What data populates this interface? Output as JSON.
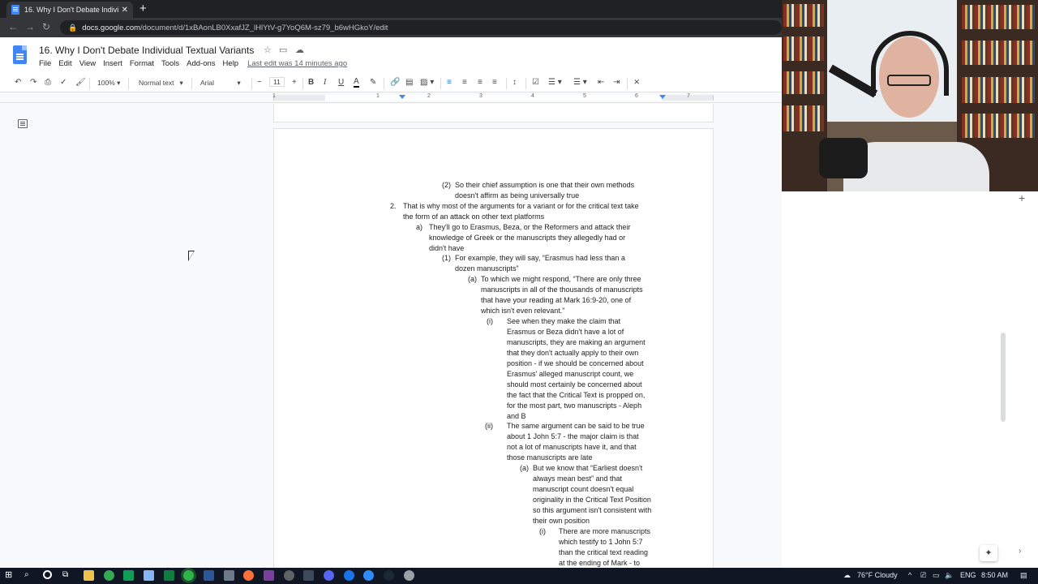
{
  "browser": {
    "tab_title": "16. Why I Don't Debate Individu",
    "url_host": "docs.google.com",
    "url_path": "/document/d/1xBAonLB0XxafJZ_lHlYtV-g7YoQ6M-sz79_b6wHGkoY/edit"
  },
  "docs": {
    "title": "16. Why I Don't Debate Individual Textual Variants",
    "menu": [
      "File",
      "Edit",
      "View",
      "Insert",
      "Format",
      "Tools",
      "Add-ons",
      "Help"
    ],
    "last_edit": "Last edit was 14 minutes ago",
    "zoom": "100%",
    "style": "Normal text",
    "font": "Arial",
    "font_size": "11"
  },
  "ruler": [
    "1",
    "1",
    "2",
    "3",
    "4",
    "5",
    "6",
    "7"
  ],
  "document_lines": [
    {
      "marker": "(2)",
      "text": "So their chief assumption is one that their own methods"
    },
    {
      "marker": "",
      "text": "doesn't affirm as being universally true"
    },
    {
      "marker": "2.",
      "text": "That is why most of the arguments for a variant or for the critical text take"
    },
    {
      "marker": "",
      "text": "the form of an attack on other text platforms"
    },
    {
      "marker": "a)",
      "text": "They'll go to Erasmus, Beza, or the Reformers and attack their"
    },
    {
      "marker": "",
      "text": "knowledge of Greek or the manuscripts they allegedly had or"
    },
    {
      "marker": "",
      "text": "didn't have"
    },
    {
      "marker": "(1)",
      "text": "For example, they will say, “Erasmus had less than a"
    },
    {
      "marker": "",
      "text": "dozen manuscripts”"
    },
    {
      "marker": "(a)",
      "text": "To which we might respond, “There are only three"
    },
    {
      "marker": "",
      "text": "manuscripts in all of the thousands of manuscripts"
    },
    {
      "marker": "",
      "text": "that have your reading at Mark 16:9-20, one of"
    },
    {
      "marker": "",
      "text": "which isn't even relevant.”"
    },
    {
      "marker": "(i)",
      "text": "See when they make the claim that"
    },
    {
      "marker": "",
      "text": "Erasmus or Beza didn't have a lot of"
    },
    {
      "marker": "",
      "text": "manuscripts, they are making an argument"
    },
    {
      "marker": "",
      "text": "that they don't actually apply to their own"
    },
    {
      "marker": "",
      "text": "position - if we should be concerned about"
    },
    {
      "marker": "",
      "text": "Erasmus' alleged manuscript count, we"
    },
    {
      "marker": "",
      "text": "should most certainly be concerned about"
    },
    {
      "marker": "",
      "text": "the fact that the Critical Text is propped on,"
    },
    {
      "marker": "",
      "text": "for the most part, two manuscripts - Aleph"
    },
    {
      "marker": "",
      "text": "and B"
    },
    {
      "marker": "(ii)",
      "text": "The same argument can be said to be true"
    },
    {
      "marker": "",
      "text": "about 1 John 5:7 - the major claim is that"
    },
    {
      "marker": "",
      "text": "not a lot of manuscripts have it, and that"
    },
    {
      "marker": "",
      "text": "those manuscripts are late"
    },
    {
      "marker": "(a)",
      "text": "But we know that “Earliest doesn't"
    },
    {
      "marker": "",
      "text": "always mean best” and that"
    },
    {
      "marker": "",
      "text": "manuscript count doesn't equal"
    },
    {
      "marker": "",
      "text": "originality in the Critical Text Position"
    },
    {
      "marker": "",
      "text": "so this argument isn't consistent with"
    },
    {
      "marker": "",
      "text": "their own position"
    },
    {
      "marker": "(i)",
      "text": "There are more manuscripts"
    },
    {
      "marker": "",
      "text": "which testify to 1 John 5:7"
    },
    {
      "marker": "",
      "text": "than the critical text reading"
    },
    {
      "marker": "",
      "text": "at the ending of Mark - to"
    }
  ],
  "taskbar": {
    "weather": "76°F  Cloudy",
    "lang": "ENG",
    "time": "8:50 AM"
  }
}
